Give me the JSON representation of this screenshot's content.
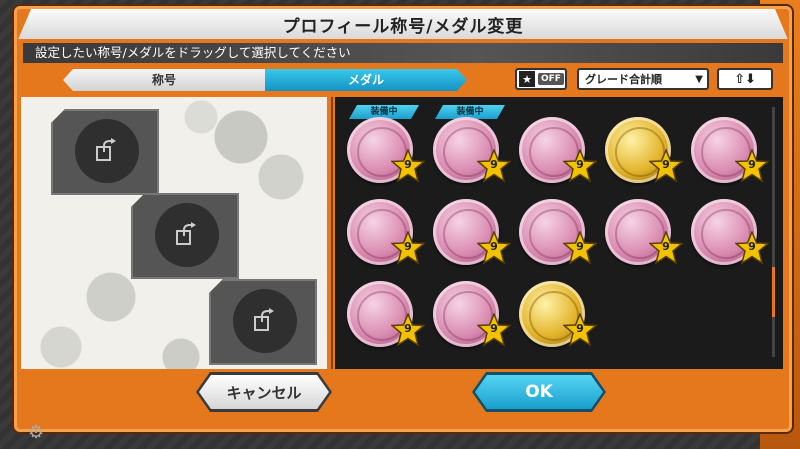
{
  "dialog": {
    "title": "プロフィール称号/メダル変更",
    "instruction": "設定したい称号/メダルをドラッグして選択してください"
  },
  "tabs": [
    {
      "label": "称号",
      "active": false
    },
    {
      "label": "メダル",
      "active": true
    }
  ],
  "filter": {
    "star_icon": "★",
    "star_toggle": "OFF",
    "sort_label": "グレード合計順",
    "sort_arrow": "▼",
    "order_icon": "⇧⬇"
  },
  "slots": [
    {
      "icon": "swap-arrow-icon"
    },
    {
      "icon": "swap-arrow-icon"
    },
    {
      "icon": "swap-arrow-icon"
    }
  ],
  "medals": [
    {
      "color": "pink",
      "grade": "9",
      "equipped": true
    },
    {
      "color": "pink",
      "grade": "9",
      "equipped": true
    },
    {
      "color": "pink",
      "grade": "9",
      "equipped": false
    },
    {
      "color": "gold",
      "grade": "9",
      "equipped": false
    },
    {
      "color": "pink",
      "grade": "9",
      "equipped": false
    },
    {
      "color": "pink",
      "grade": "9",
      "equipped": false
    },
    {
      "color": "pink",
      "grade": "9",
      "equipped": false
    },
    {
      "color": "pink",
      "grade": "9",
      "equipped": false
    },
    {
      "color": "pink",
      "grade": "9",
      "equipped": false
    },
    {
      "color": "pink",
      "grade": "9",
      "equipped": false
    },
    {
      "color": "pink",
      "grade": "9",
      "equipped": false
    },
    {
      "color": "pink",
      "grade": "9",
      "equipped": false
    },
    {
      "color": "gold",
      "grade": "9",
      "equipped": false
    }
  ],
  "equipped_label": "装備中",
  "buttons": {
    "cancel": "キャンセル",
    "ok": "OK"
  },
  "colors": {
    "frame_orange": "#e5781d",
    "accent_cyan": "#1a9fcd",
    "grade_star": "#f2c200"
  },
  "scroll": {
    "thumb_position": 0.8
  }
}
